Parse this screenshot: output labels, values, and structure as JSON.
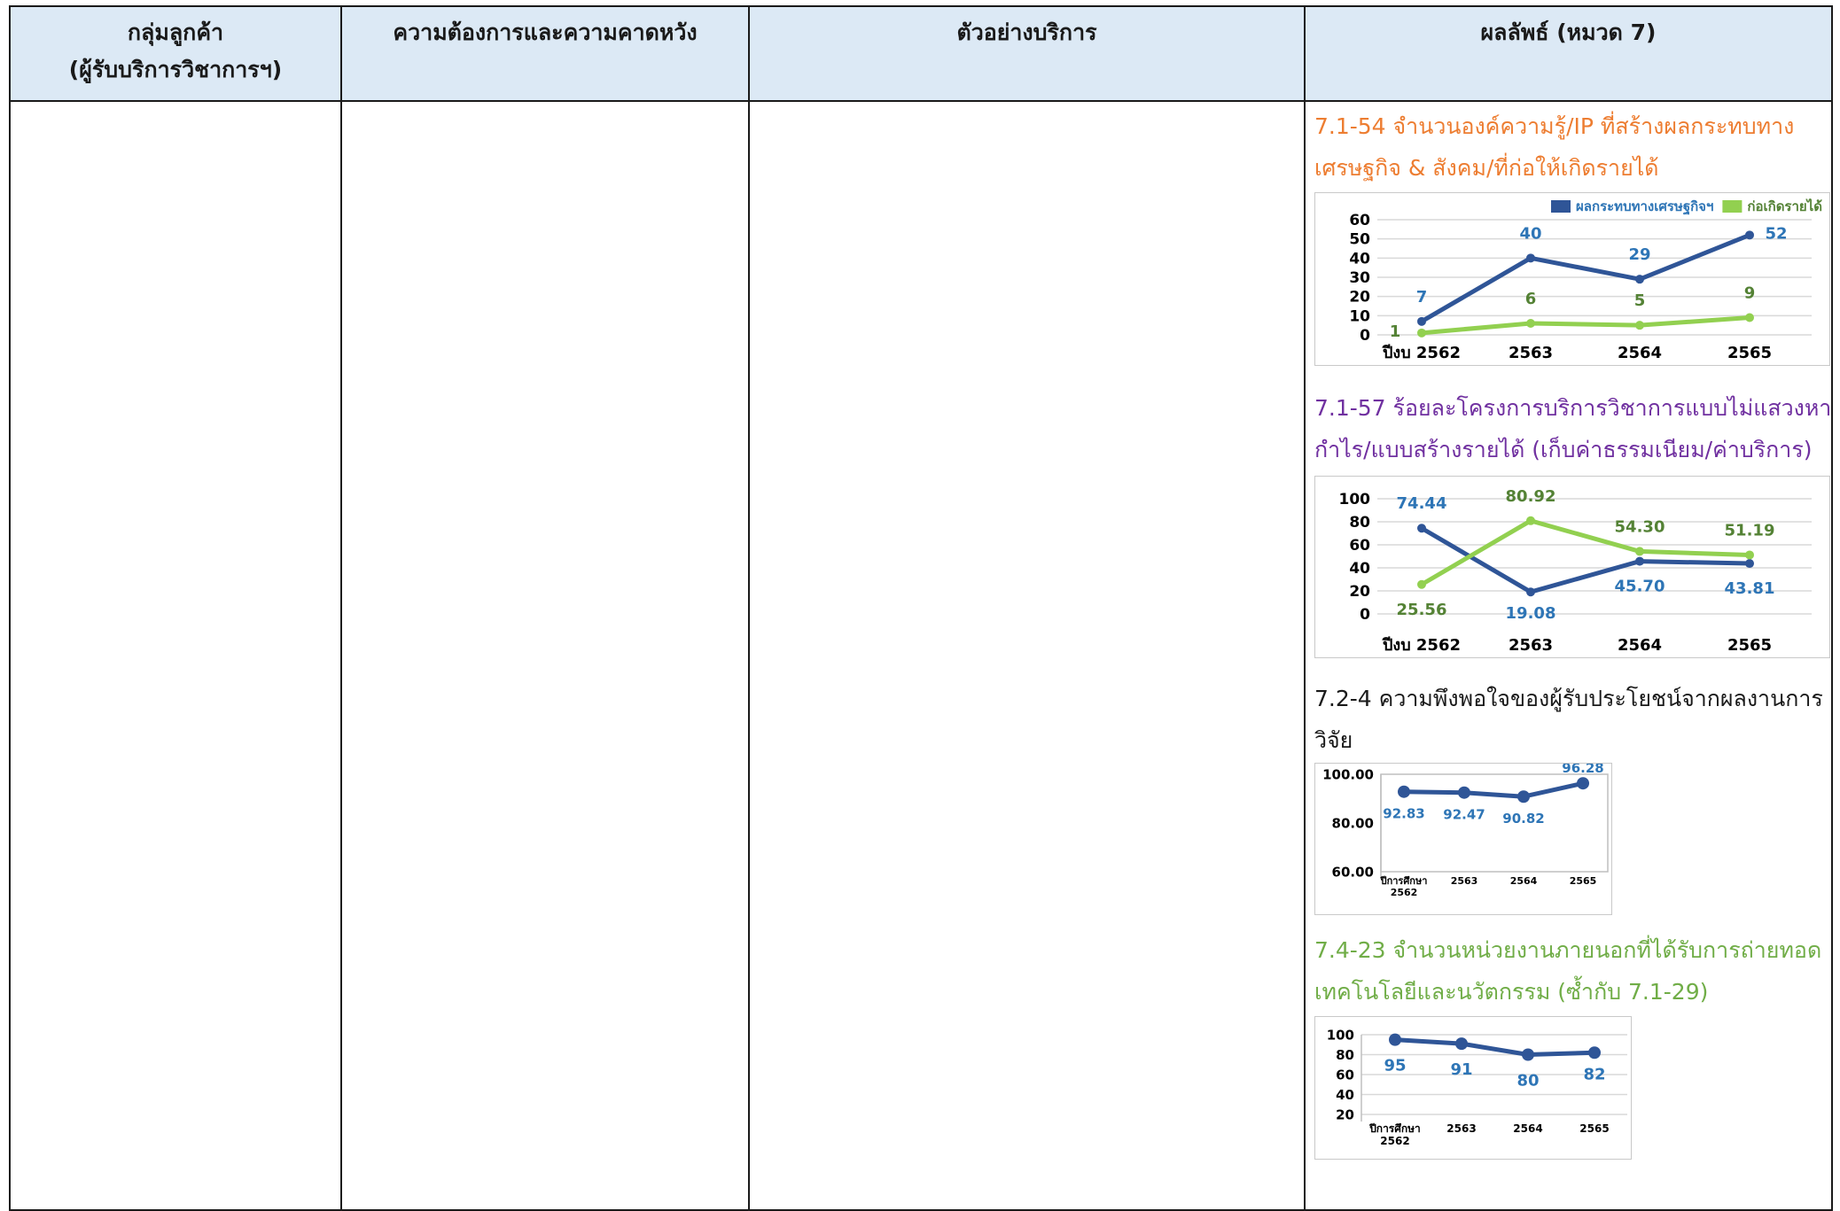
{
  "table": {
    "headers": [
      {
        "line1": "กลุ่มลูกค้า",
        "line2": "(ผู้รับบริการวิชาการฯ)"
      },
      {
        "line1": "ความต้องการและความคาดหวัง"
      },
      {
        "line1": "ตัวอย่างบริการ"
      },
      {
        "line1": "ผลลัพธ์ (หมวด 7)"
      }
    ]
  },
  "kpis": [
    {
      "title_line1": "7.1-54 จำนวนองค์ความรู้/IP ที่สร้างผลกระทบทาง",
      "title_line2": "เศรษฐกิจ & สังคม/ที่ก่อให้เกิดรายได้"
    },
    {
      "title_line1": "7.1-57 ร้อยละโครงการบริการวิชาการแบบไม่แสวงหา",
      "title_line2": "กำไร/แบบสร้างรายได้ (เก็บค่าธรรมเนียม/ค่าบริการ)"
    },
    {
      "title_line1": "7.2-4 ความพึงพอใจของผู้รับประโยชน์จากผลงานการ",
      "title_line2": "วิจัย"
    },
    {
      "title_line1": "7.4-23 จำนวนหน่วยงานภายนอกที่ได้รับการถ่ายทอด",
      "title_line2": "เทคโนโลยีและนวัตกรรม (ซ้ำกับ 7.1-29)"
    }
  ],
  "chart_data": [
    {
      "type": "line",
      "categories": [
        "ปีงบ 2562",
        "2563",
        "2564",
        "2565"
      ],
      "ylim": [
        0,
        60
      ],
      "yticks": [
        "60",
        "50",
        "40",
        "30",
        "20",
        "10",
        "0"
      ],
      "legend_position": "top-right",
      "series": [
        {
          "name": "ผลกระทบทางเศรษฐกิจฯ",
          "color": "#2f5597",
          "label_color": "#2e75b6",
          "values": [
            7,
            40,
            29,
            52
          ],
          "labels": [
            "7",
            "40",
            "29",
            "52"
          ]
        },
        {
          "name": "ก่อเกิดรายได้",
          "color": "#92d050",
          "label_color": "#548235",
          "values": [
            1,
            6,
            5,
            9
          ],
          "labels": [
            "1",
            "6",
            "5",
            "9"
          ]
        }
      ]
    },
    {
      "type": "line",
      "categories": [
        "ปีงบ 2562",
        "2563",
        "2564",
        "2565"
      ],
      "ylim": [
        0,
        100
      ],
      "yticks": [
        "100",
        "80",
        "60",
        "40",
        "20",
        "0"
      ],
      "series": [
        {
          "color": "#2f5597",
          "label_color": "#2e75b6",
          "values": [
            74.44,
            19.08,
            45.7,
            43.81
          ],
          "labels": [
            "74.44",
            "19.08",
            "45.70",
            "43.81"
          ]
        },
        {
          "color": "#92d050",
          "label_color": "#548235",
          "values": [
            25.56,
            80.92,
            54.3,
            51.19
          ],
          "labels": [
            "25.56",
            "80.92",
            "54.30",
            "51.19"
          ]
        }
      ]
    },
    {
      "type": "line",
      "categories": [
        [
          "ปีการศึกษา",
          "2562"
        ],
        [
          "2563"
        ],
        [
          "2564"
        ],
        [
          "2565"
        ]
      ],
      "ylim": [
        60,
        100
      ],
      "yticks": [
        "100.00",
        "80.00",
        "60.00"
      ],
      "series": [
        {
          "color": "#2f5597",
          "label_color": "#2e75b6",
          "values": [
            92.83,
            92.47,
            90.82,
            96.28
          ],
          "labels": [
            "92.83",
            "92.47",
            "90.82",
            "96.28"
          ]
        }
      ]
    },
    {
      "type": "line",
      "categories": [
        [
          "ปีการศึกษา",
          "2562"
        ],
        [
          "2563"
        ],
        [
          "2564"
        ],
        [
          "2565"
        ]
      ],
      "ylim": [
        20,
        100
      ],
      "yticks": [
        "100",
        "80",
        "60",
        "40",
        "20"
      ],
      "series": [
        {
          "color": "#2f5597",
          "label_color": "#2e75b6",
          "values": [
            95,
            91,
            80,
            82
          ],
          "labels": [
            "95",
            "91",
            "80",
            "82"
          ]
        }
      ]
    }
  ]
}
